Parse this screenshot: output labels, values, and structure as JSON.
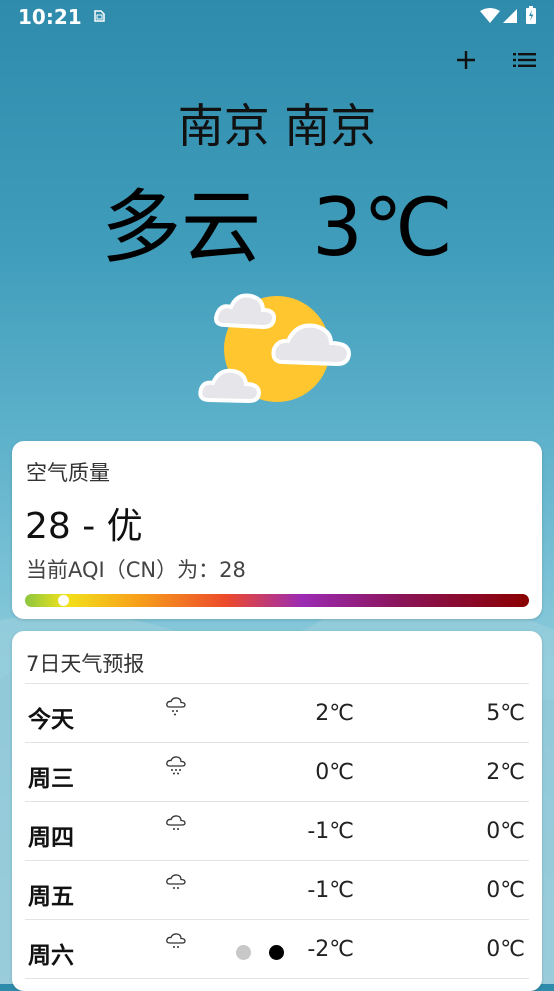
{
  "status_bar": {
    "time": "10:21",
    "icons": [
      "sim-card-icon",
      "wifi-icon",
      "signal-icon",
      "battery-icon"
    ]
  },
  "toolbar": {
    "add_icon": "plus-icon",
    "menu_icon": "list-icon"
  },
  "location": {
    "city": "南京 南京"
  },
  "current": {
    "condition": "多云",
    "temperature": "3℃",
    "icon": "partly-cloudy-icon"
  },
  "aqi": {
    "title": "空气质量",
    "value_text": "28 - 优",
    "description": "当前AQI（CN）为：28",
    "aqi_value": 28,
    "indicator_position_fraction": 0.065
  },
  "forecast": {
    "title": "7日天气预报",
    "rows": [
      {
        "day": "今天",
        "icon": "snow-cloud-icon",
        "low": "2℃",
        "high": "5℃"
      },
      {
        "day": "周三",
        "icon": "snow-cloud-icon",
        "low": "0℃",
        "high": "2℃"
      },
      {
        "day": "周四",
        "icon": "snow-cloud-icon",
        "low": "-1℃",
        "high": "0℃"
      },
      {
        "day": "周五",
        "icon": "snow-cloud-icon",
        "low": "-1℃",
        "high": "0℃"
      },
      {
        "day": "周六",
        "icon": "snow-cloud-icon",
        "low": "-2℃",
        "high": "0℃"
      }
    ],
    "page_indicator": {
      "count": 2,
      "active_index": 1
    }
  },
  "colors": {
    "sky_top": "#2f8bab",
    "sky_bottom": "#a4d6e3",
    "sun": "#ffc62f",
    "cloud": "#e8e8ec",
    "dot_inactive": "#c8c8c8",
    "dot_active": "#000000"
  }
}
